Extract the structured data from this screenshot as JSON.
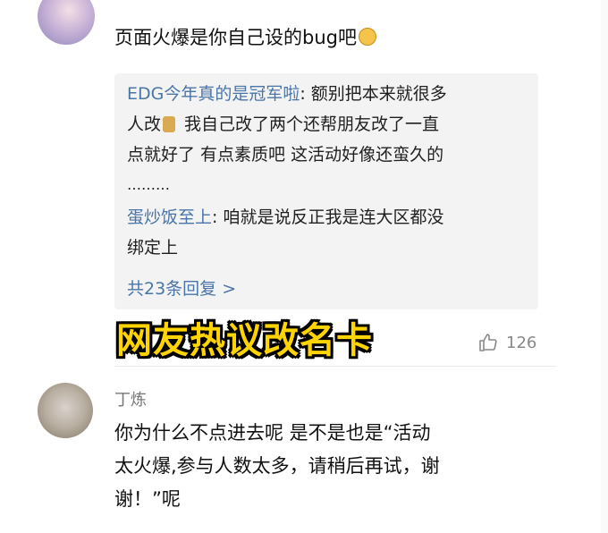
{
  "comment1": {
    "text": "页面火爆是你自己设的bug吧",
    "emoji": "laughing-face-icon"
  },
  "replies": {
    "line1_name": "EDG今年真的是冠军啦",
    "line1_text": ": 额别把本来就很多",
    "line2": "人改",
    "line2_icon": "person-emoji-icon",
    "line2_tail": " 我自己改了两个还帮朋友改了一直",
    "line3": "点就好了 有点素质吧 这活动好像还蛮久的",
    "line4": "………",
    "line5_name": "蛋炒饭至上",
    "line5_text": ": 咱就是说反正我是连大区都没",
    "line6": "绑定上",
    "more": "共23条回复 >"
  },
  "overlay_title": "网友热议改名卡",
  "likes": {
    "icon": "thumbs-up-icon",
    "count": "126"
  },
  "comment2": {
    "username": "丁炼",
    "text_line1": "你为什么不点进去呢 是不是也是“活动",
    "text_line2": "太火爆,参与人数太多，请稍后再试，谢",
    "text_line3": "谢！”呢"
  }
}
